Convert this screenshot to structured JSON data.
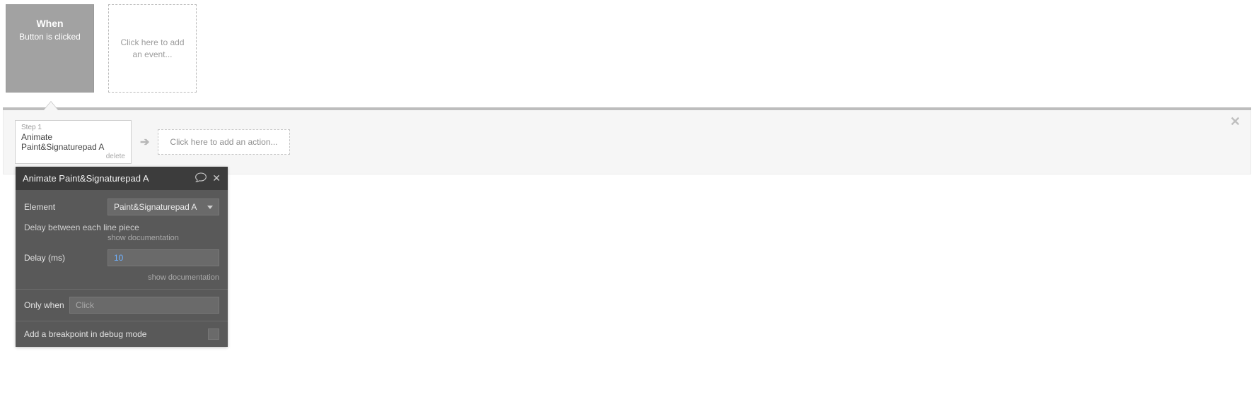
{
  "events": {
    "selected": {
      "when_label": "When",
      "condition": "Button is clicked"
    },
    "add_event_text": "Click here to add an event..."
  },
  "actions": {
    "step": {
      "number_label": "Step 1",
      "title": "Animate Paint&Signaturepad A",
      "delete_label": "delete"
    },
    "add_action_text": "Click here to add an action..."
  },
  "panel": {
    "title": "Animate Paint&Signaturepad A",
    "element_label": "Element",
    "element_value": "Paint&Signaturepad A",
    "delay_section_note": "Delay between each line piece",
    "show_doc_label": "show documentation",
    "delay_label": "Delay (ms)",
    "delay_value": "10",
    "only_when_label": "Only when",
    "only_when_placeholder": "Click",
    "breakpoint_label": "Add a breakpoint in debug mode"
  }
}
